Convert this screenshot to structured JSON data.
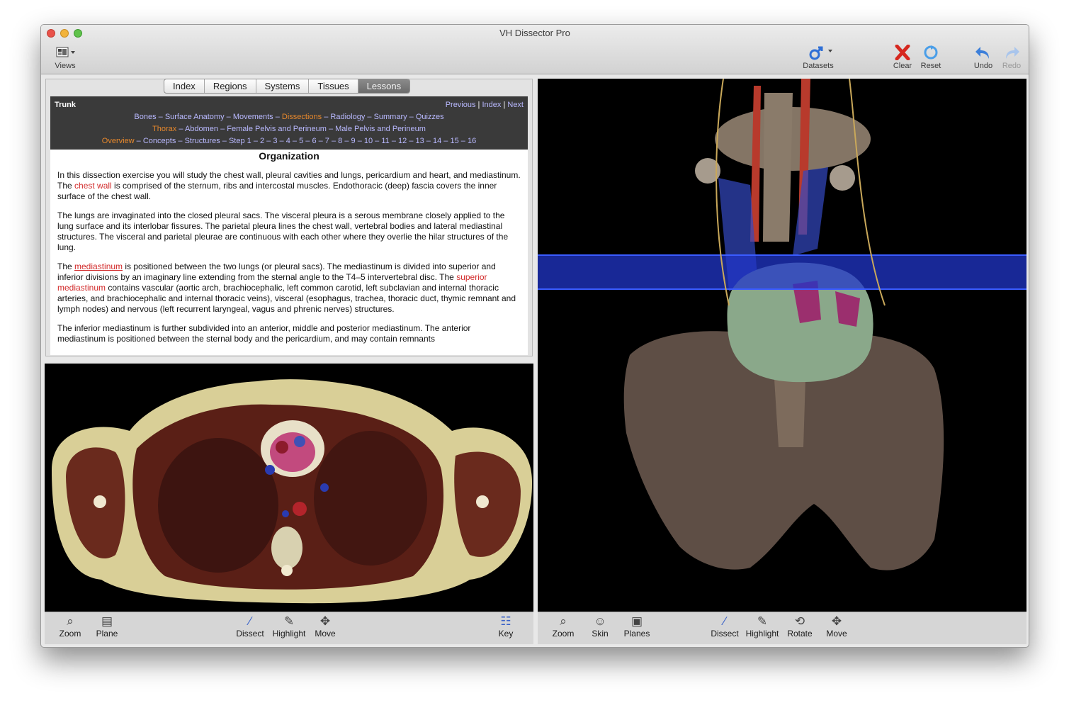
{
  "window": {
    "title": "VH Dissector Pro"
  },
  "toolbar": {
    "views": "Views",
    "datasets": "Datasets",
    "clear": "Clear",
    "reset": "Reset",
    "undo": "Undo",
    "redo": "Redo"
  },
  "tabs": [
    "Index",
    "Regions",
    "Systems",
    "Tissues",
    "Lessons"
  ],
  "lesson_header": {
    "title": "Trunk",
    "nav": {
      "previous": "Previous",
      "index": "Index",
      "next": "Next",
      "sep": "|"
    },
    "row1": [
      "Bones",
      "Surface Anatomy",
      "Movements",
      "Dissections",
      "Radiology",
      "Summary",
      "Quizzes"
    ],
    "row2": [
      "Thorax",
      "Abdomen",
      "Female Pelvis and Perineum",
      "Male Pelvis and Perineum"
    ],
    "row3": [
      "Overview",
      "Concepts",
      "Structures",
      "Step 1",
      "2",
      "3",
      "4",
      "5",
      "6",
      "7",
      "8",
      "9",
      "10",
      "11",
      "12",
      "13",
      "14",
      "15",
      "16"
    ],
    "separator": " – "
  },
  "lesson": {
    "heading": "Organization",
    "p1_a": "In this dissection exercise you will study the chest wall, pleural cavities and lungs, pericardium and heart, and mediastinum. The ",
    "p1_link": "chest wall",
    "p1_b": " is comprised of the sternum, ribs and intercostal muscles. Endothoracic (deep) fascia covers the inner surface of the chest wall.",
    "p2": "The lungs are invaginated into the closed pleural sacs. The visceral pleura is a serous membrane closely applied to the lung surface and its interlobar fissures. The parietal pleura lines the chest wall, vertebral bodies and lateral mediastinal structures. The visceral and parietal pleurae are continuous with each other where they overlie the hilar structures of the lung.",
    "p3_a": "The ",
    "p3_link1": "mediastinum",
    "p3_b": " is positioned between the two lungs (or pleural sacs). The mediastinum is divided into superior and inferior divisions by an imaginary line extending from the sternal angle to the T4–5 intervertebral disc. The ",
    "p3_link2": "superior mediastinum",
    "p3_c": " contains vascular (aortic arch, brachiocephalic, left common carotid, left subclavian and internal thoracic arteries, and brachiocephalic and internal thoracic veins), visceral (esophagus, trachea, thoracic duct, thymic remnant and lymph nodes) and nervous (left recurrent laryngeal, vagus and phrenic nerves) structures.",
    "p4": "The inferior mediastinum is further subdivided into an anterior, middle and posterior mediastinum. The anterior mediastinum is positioned between the sternal body and the pericardium, and may contain remnants"
  },
  "left_toolbar": {
    "zoom": "Zoom",
    "plane": "Plane",
    "dissect": "Dissect",
    "highlight": "Highlight",
    "move": "Move",
    "key": "Key"
  },
  "right_toolbar": {
    "zoom": "Zoom",
    "skin": "Skin",
    "planes": "Planes",
    "dissect": "Dissect",
    "highlight": "Highlight",
    "rotate": "Rotate",
    "move": "Move"
  },
  "colors": {
    "accent_orange": "#e7882c",
    "link_red": "#d22b2b",
    "nav_link": "#b9b9ff",
    "plane_blue": "#2036c8"
  }
}
